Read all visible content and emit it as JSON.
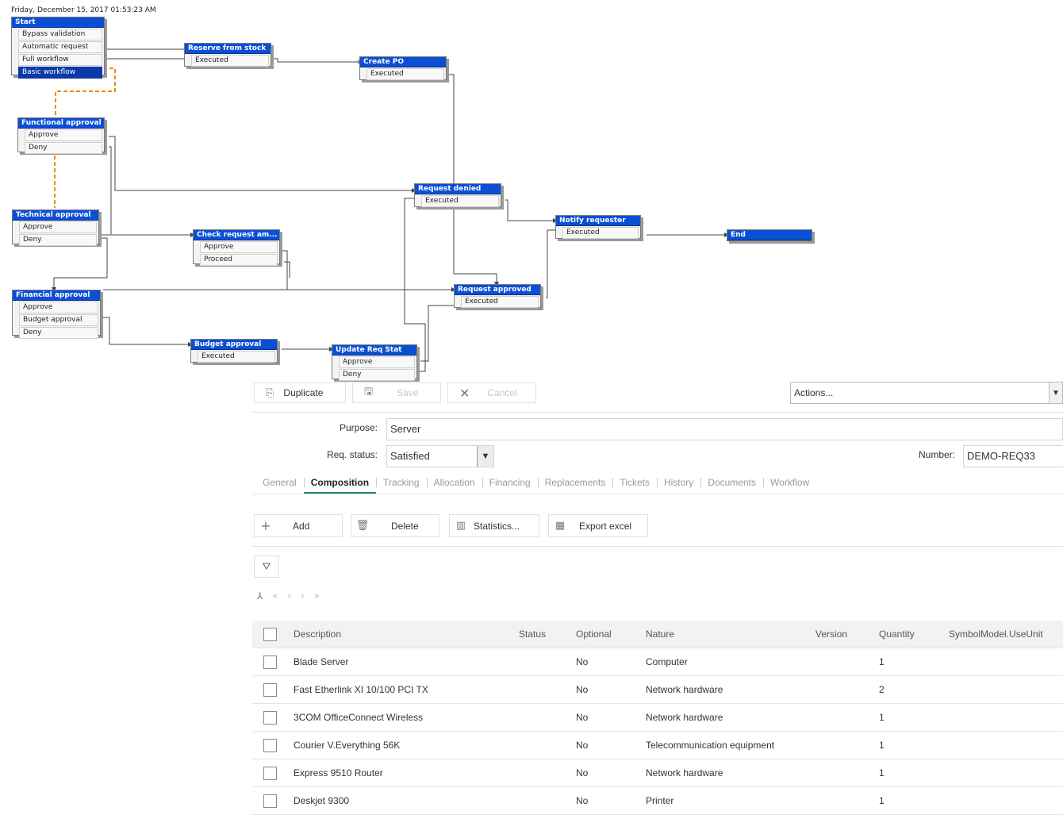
{
  "workflow": {
    "timestamp": "Friday, December 15, 2017 01:53:23 AM",
    "nodes": {
      "start": {
        "title": "Start",
        "options": [
          "Bypass validation",
          "Automatic request",
          "Full workflow",
          "Basic workflow"
        ]
      },
      "reserve": {
        "title": "Reserve from stock",
        "options": [
          "Executed"
        ]
      },
      "create_po": {
        "title": "Create PO",
        "options": [
          "Executed"
        ]
      },
      "functional": {
        "title": "Functional approval",
        "options": [
          "Approve",
          "Deny"
        ]
      },
      "request_denied": {
        "title": "Request denied",
        "options": [
          "Executed"
        ]
      },
      "notify": {
        "title": "Notify requester",
        "options": [
          "Executed"
        ]
      },
      "end": {
        "title": "End",
        "options": []
      },
      "technical": {
        "title": "Technical approval",
        "options": [
          "Approve",
          "Deny"
        ]
      },
      "check_request": {
        "title": "Check request am...",
        "options": [
          "Approve",
          "Proceed"
        ]
      },
      "financial": {
        "title": "Financial approval",
        "options": [
          "Approve",
          "Budget approval",
          "Deny"
        ]
      },
      "request_approved": {
        "title": "Request approved",
        "options": [
          "Executed"
        ]
      },
      "budget": {
        "title": "Budget approval",
        "options": [
          "Executed"
        ]
      },
      "update_req": {
        "title": "Update Req Stat",
        "options": [
          "Approve",
          "Deny"
        ]
      }
    }
  },
  "toolbar": {
    "duplicate": "Duplicate",
    "save": "Save",
    "cancel": "Cancel",
    "actions": "Actions..."
  },
  "form": {
    "purpose_label": "Purpose:",
    "purpose_value": "Server",
    "status_label": "Req. status:",
    "status_value": "Satisfied",
    "number_label": "Number:",
    "number_value": "DEMO-REQ33"
  },
  "tabs": [
    "General",
    "Composition",
    "Tracking",
    "Allocation",
    "Financing",
    "Replacements",
    "Tickets",
    "History",
    "Documents",
    "Workflow"
  ],
  "active_tab": "Composition",
  "actions": {
    "add": "Add",
    "delete": "Delete",
    "statistics": "Statistics...",
    "export": "Export excel"
  },
  "table": {
    "columns": [
      "Description",
      "Status",
      "Optional",
      "Nature",
      "Version",
      "Quantity",
      "SymbolModel.UseUnit"
    ],
    "rows": [
      [
        "Blade Server",
        "",
        "No",
        "Computer",
        "",
        "1",
        ""
      ],
      [
        "Fast Etherlink XI 10/100 PCI TX",
        "",
        "No",
        "Network hardware",
        "",
        "2",
        ""
      ],
      [
        "3COM OfficeConnect Wireless",
        "",
        "No",
        "Network hardware",
        "",
        "1",
        ""
      ],
      [
        "Courier V.Everything 56K",
        "",
        "No",
        "Telecommunication equipment",
        "",
        "1",
        ""
      ],
      [
        "Express 9510 Router",
        "",
        "No",
        "Network hardware",
        "",
        "1",
        ""
      ],
      [
        "Deskjet 9300",
        "",
        "No",
        "Printer",
        "",
        "1",
        ""
      ]
    ]
  },
  "colors": {
    "node_header": "#0a4fd6",
    "tab_underline": "#1a8a73",
    "highlight_link": "#f08a00"
  }
}
